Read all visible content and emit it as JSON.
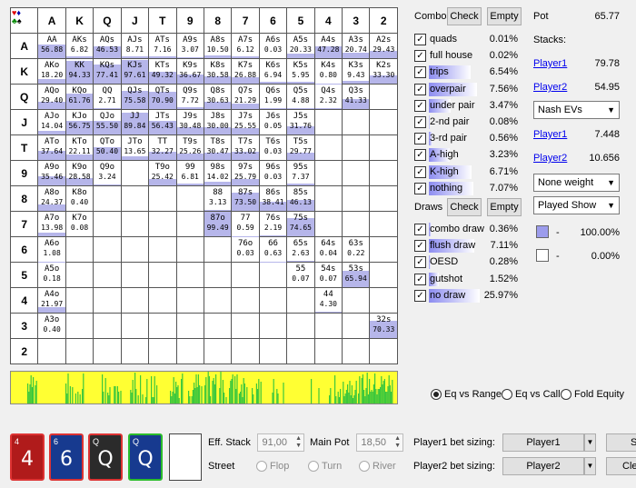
{
  "ranks": [
    "A",
    "K",
    "Q",
    "J",
    "T",
    "9",
    "8",
    "7",
    "6",
    "5",
    "4",
    "3",
    "2"
  ],
  "grid": [
    [
      [
        "AA",
        "56.88"
      ],
      [
        "AKs",
        "6.82"
      ],
      [
        "AQs",
        "46.53"
      ],
      [
        "AJs",
        "8.71"
      ],
      [
        "ATs",
        "7.16"
      ],
      [
        "A9s",
        "3.07"
      ],
      [
        "A8s",
        "10.50"
      ],
      [
        "A7s",
        "6.12"
      ],
      [
        "A6s",
        "0.03"
      ],
      [
        "A5s",
        "20.33"
      ],
      [
        "A4s",
        "47.28"
      ],
      [
        "A3s",
        "20.74"
      ],
      [
        "A2s",
        "29.43"
      ]
    ],
    [
      [
        "AKo",
        "18.20"
      ],
      [
        "KK",
        "94.33"
      ],
      [
        "KQs",
        "77.41"
      ],
      [
        "KJs",
        "97.61"
      ],
      [
        "KTs",
        "49.32"
      ],
      [
        "K9s",
        "36.67"
      ],
      [
        "K8s",
        "30.58"
      ],
      [
        "K7s",
        "26.88"
      ],
      [
        "K6s",
        "6.94"
      ],
      [
        "K5s",
        "5.95"
      ],
      [
        "K4s",
        "0.80"
      ],
      [
        "K3s",
        "9.43"
      ],
      [
        "K2s",
        "33.30"
      ]
    ],
    [
      [
        "AQo",
        "29.40"
      ],
      [
        "KQo",
        "61.76"
      ],
      [
        "QQ",
        "2.71"
      ],
      [
        "QJs",
        "75.58"
      ],
      [
        "QTs",
        "70.90"
      ],
      [
        "Q9s",
        "7.72"
      ],
      [
        "Q8s",
        "30.63"
      ],
      [
        "Q7s",
        "21.29"
      ],
      [
        "Q6s",
        "1.99"
      ],
      [
        "Q5s",
        "4.88"
      ],
      [
        "Q4s",
        "2.32"
      ],
      [
        "Q3s",
        "41.33"
      ],
      null
    ],
    [
      [
        "AJo",
        "14.04"
      ],
      [
        "KJo",
        "56.75"
      ],
      [
        "QJo",
        "55.50"
      ],
      [
        "JJ",
        "89.84"
      ],
      [
        "JTs",
        "56.43"
      ],
      [
        "J9s",
        "30.48"
      ],
      [
        "J8s",
        "30.00"
      ],
      [
        "J7s",
        "25.55"
      ],
      [
        "J6s",
        "0.05"
      ],
      [
        "J5s",
        "31.76"
      ],
      null,
      null,
      null
    ],
    [
      [
        "ATo",
        "37.64"
      ],
      [
        "KTo",
        "22.11"
      ],
      [
        "QTo",
        "50.40"
      ],
      [
        "JTo",
        "13.65"
      ],
      [
        "TT",
        "32.27"
      ],
      [
        "T9s",
        "25.26"
      ],
      [
        "T8s",
        "30.47"
      ],
      [
        "T7s",
        "33.02"
      ],
      [
        "T6s",
        "0.03"
      ],
      [
        "T5s",
        "29.77"
      ],
      null,
      null,
      null
    ],
    [
      [
        "A9o",
        "35.46"
      ],
      [
        "K9o",
        "28.58"
      ],
      [
        "Q9o",
        "3.24"
      ],
      null,
      [
        "T9o",
        "25.42"
      ],
      [
        "99",
        "6.81"
      ],
      [
        "98s",
        "14.02"
      ],
      [
        "97s",
        "25.79"
      ],
      [
        "96s",
        "0.03"
      ],
      [
        "95s",
        "7.37"
      ],
      null,
      null,
      null
    ],
    [
      [
        "A8o",
        "24.37"
      ],
      [
        "K8o",
        "0.40"
      ],
      null,
      null,
      null,
      null,
      [
        "88",
        "3.13"
      ],
      [
        "87s",
        "73.50"
      ],
      [
        "86s",
        "38.41"
      ],
      [
        "85s",
        "46.13"
      ],
      null,
      null,
      null
    ],
    [
      [
        "A7o",
        "13.98"
      ],
      [
        "K7o",
        "0.08"
      ],
      null,
      null,
      null,
      null,
      [
        "87o",
        "99.49"
      ],
      [
        "77",
        "0.59"
      ],
      [
        "76s",
        "2.19"
      ],
      [
        "75s",
        "74.65"
      ],
      null,
      null,
      null
    ],
    [
      [
        "A6o",
        "1.08"
      ],
      null,
      null,
      null,
      null,
      null,
      null,
      [
        "76o",
        "0.03"
      ],
      [
        "66",
        "0.63"
      ],
      [
        "65s",
        "2.63"
      ],
      [
        "64s",
        "0.04"
      ],
      [
        "63s",
        "0.22"
      ],
      null
    ],
    [
      [
        "A5o",
        "0.18"
      ],
      null,
      null,
      null,
      null,
      null,
      null,
      null,
      null,
      [
        "55",
        "0.07"
      ],
      [
        "54s",
        "0.07"
      ],
      [
        "53s",
        "65.94"
      ],
      null
    ],
    [
      [
        "A4o",
        "21.97"
      ],
      null,
      null,
      null,
      null,
      null,
      null,
      null,
      null,
      null,
      [
        "44",
        "4.30"
      ],
      null,
      null
    ],
    [
      [
        "A3o",
        "0.40"
      ],
      null,
      null,
      null,
      null,
      null,
      null,
      null,
      null,
      null,
      null,
      null,
      [
        "32s",
        "70.33"
      ]
    ],
    [
      null,
      null,
      null,
      null,
      null,
      null,
      null,
      null,
      null,
      null,
      null,
      null,
      null
    ]
  ],
  "combos": {
    "title": "Combos",
    "check": "Check",
    "empty": "Empty",
    "rows": [
      {
        "name": "quads",
        "pct": "0.01%",
        "v": 0.01
      },
      {
        "name": "full house",
        "pct": "0.02%",
        "v": 0.02
      },
      {
        "name": "trips",
        "pct": "6.54%",
        "v": 6.54
      },
      {
        "name": "overpair",
        "pct": "7.56%",
        "v": 7.56
      },
      {
        "name": "under pair",
        "pct": "3.47%",
        "v": 3.47
      },
      {
        "name": "2-nd pair",
        "pct": "0.08%",
        "v": 0.08
      },
      {
        "name": "3-rd pair",
        "pct": "0.56%",
        "v": 0.56
      },
      {
        "name": "A-high",
        "pct": "3.23%",
        "v": 3.23
      },
      {
        "name": "K-high",
        "pct": "6.71%",
        "v": 6.71
      },
      {
        "name": "nothing",
        "pct": "7.07%",
        "v": 7.07
      }
    ]
  },
  "draws": {
    "title": "Draws",
    "check": "Check",
    "empty": "Empty",
    "rows": [
      {
        "name": "combo draw",
        "pct": "0.36%",
        "v": 0.36
      },
      {
        "name": "flush draw",
        "pct": "7.11%",
        "v": 7.11
      },
      {
        "name": "OESD",
        "pct": "0.28%",
        "v": 0.28
      },
      {
        "name": "gutshot",
        "pct": "1.52%",
        "v": 1.52
      },
      {
        "name": "no draw",
        "pct": "25.97%",
        "v": 25.97
      }
    ]
  },
  "right": {
    "pot_label": "Pot",
    "pot_value": "65.77",
    "stacks_label": "Stacks:",
    "p1": "Player1",
    "p1_stack": "79.78",
    "p2": "Player2",
    "p2_stack": "54.95",
    "ev_select": "Nash EVs",
    "p1_ev": "7.448",
    "p2_ev": "10.656",
    "weight_select": "None weight",
    "show_select": "Played Show",
    "legend1_dash": "-",
    "legend1_pct": "100.00%",
    "legend2_dash": "-",
    "legend2_pct": "0.00%"
  },
  "equity_radios": [
    "Eq vs Range",
    "Eq vs Call",
    "Fold Equity"
  ],
  "cards": [
    {
      "rank": "4",
      "big": "4",
      "suit": "♥",
      "color": "#b01b1b"
    },
    {
      "rank": "6",
      "big": "6",
      "suit": "♦",
      "color": "#173a8f"
    },
    {
      "rank": "Q",
      "big": "Q",
      "suit": "♠",
      "color": "#2b2b2b"
    },
    {
      "rank": "Q",
      "big": "Q",
      "suit": "♣",
      "color": "#173a8f"
    }
  ],
  "bottom": {
    "eff_stack_label": "Eff. Stack",
    "eff_stack_value": "91,00",
    "main_pot_label": "Main Pot",
    "main_pot_value": "18,50",
    "street_label": "Street",
    "streets": [
      "Flop",
      "Turn",
      "River"
    ],
    "p1_sizing_label": "Player1 bet sizing:",
    "p1_sizing_value": "Player1",
    "p2_sizing_label": "Player2 bet sizing:",
    "p2_sizing_value": "Player2",
    "btn_s": "S",
    "btn_cle": "Cle"
  },
  "colors": {
    "bar": "#b6b6ea",
    "equity_green": "#3cc83c",
    "equity_yellow": "#ffff33"
  }
}
